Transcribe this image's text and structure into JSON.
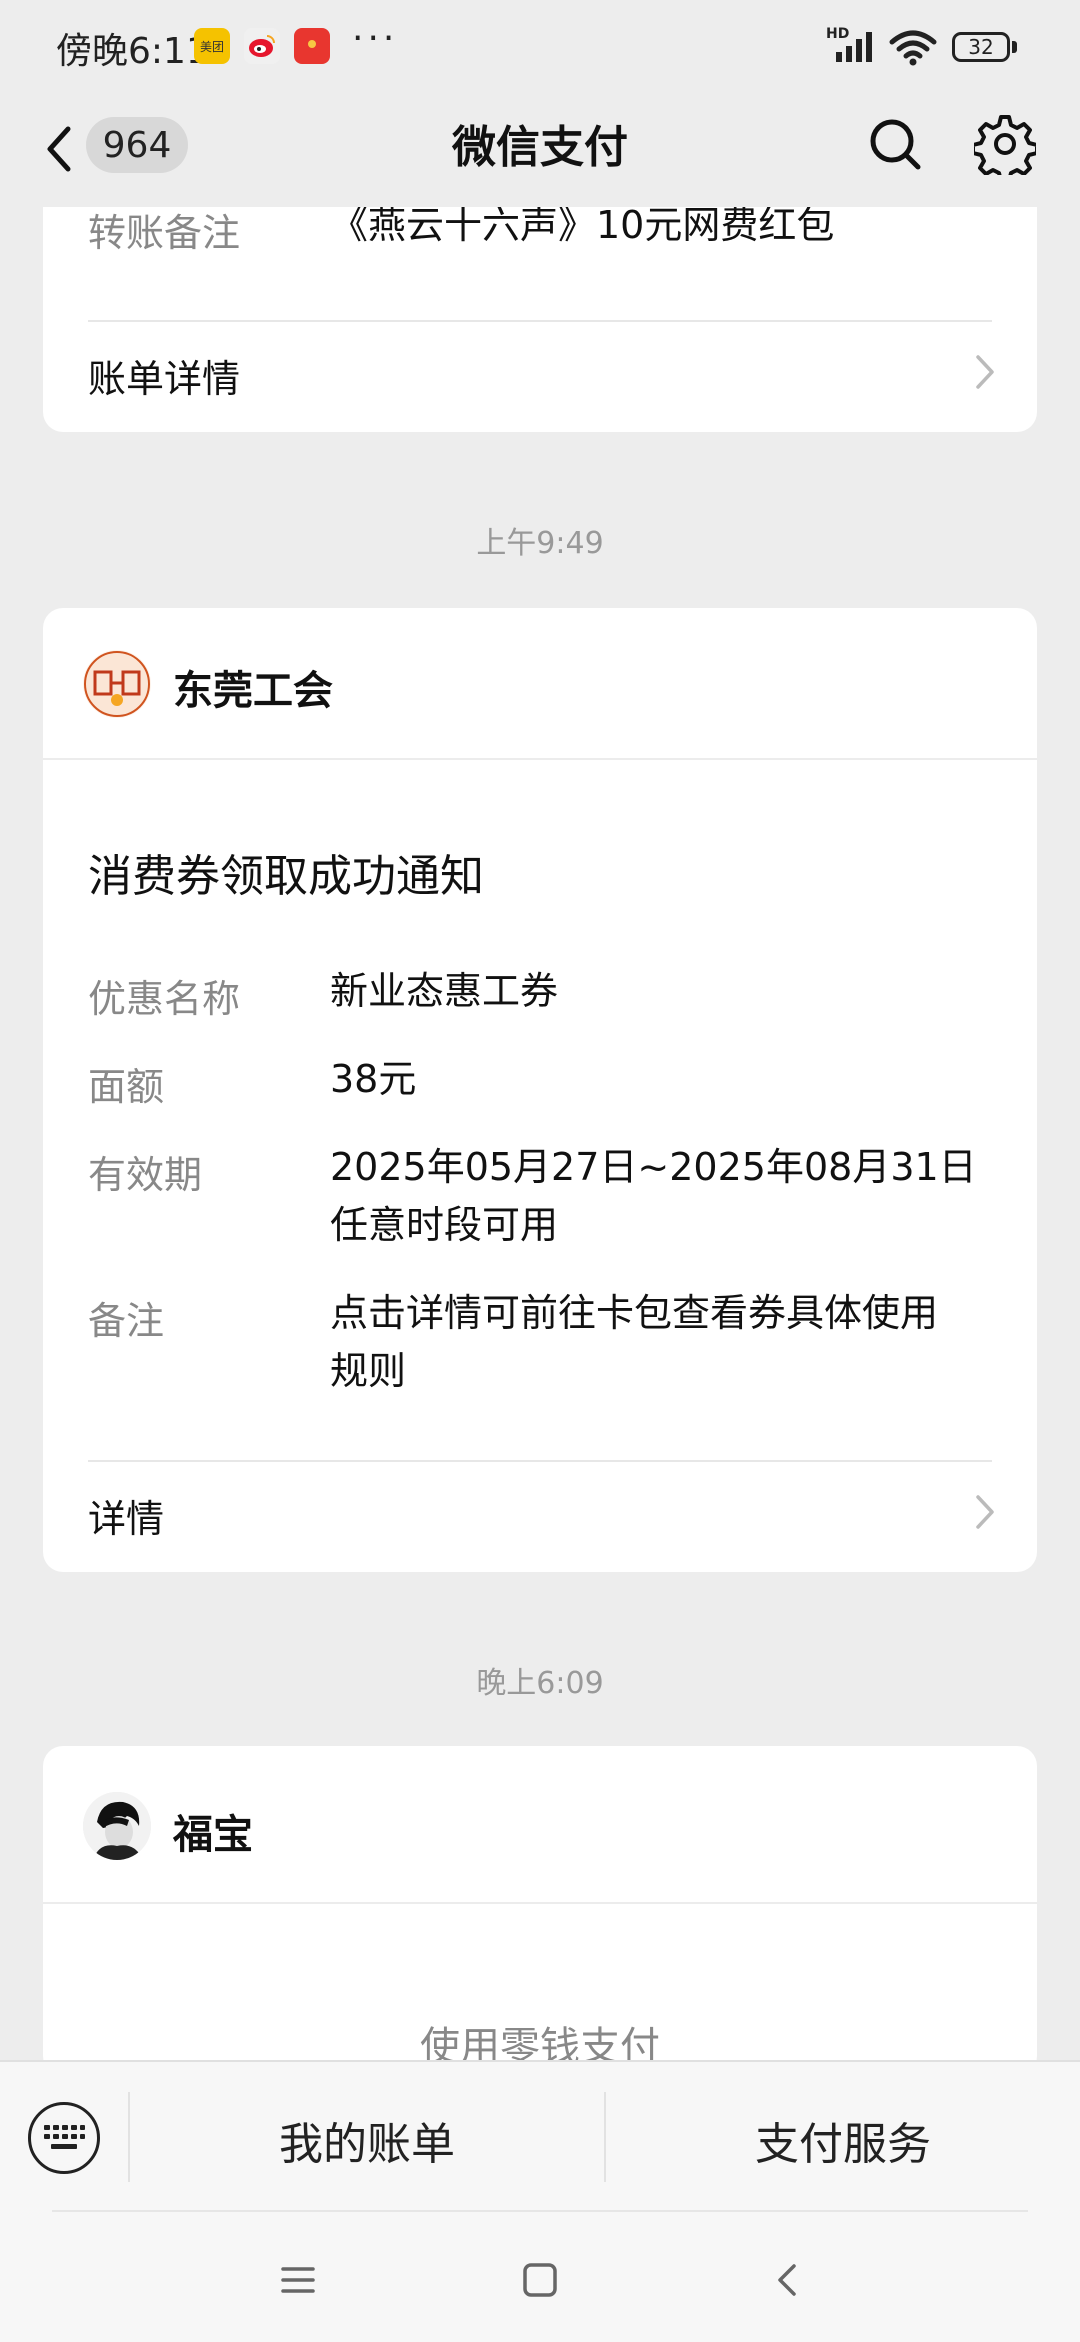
{
  "status_bar": {
    "time": "傍晚6:11",
    "apps": [
      "美团",
      "微博",
      "红包"
    ],
    "more": "···",
    "network": "HD",
    "battery": "32"
  },
  "nav": {
    "unread_count": "964",
    "title": "微信支付"
  },
  "card1": {
    "remark_label": "转账备注",
    "remark_value": "《燕云十六声》10元网费红包",
    "detail_link": "账单详情"
  },
  "time1": "上午9:49",
  "card2": {
    "sender": "东莞工会",
    "title": "消费券领取成功通知",
    "fields": [
      {
        "label": "优惠名称",
        "value": "新业态惠工券"
      },
      {
        "label": "面额",
        "value": "38元"
      },
      {
        "label": "有效期",
        "value": "2025年05月27日~2025年08月31日",
        "value2": "任意时段可用"
      },
      {
        "label": "备注",
        "value": "点击详情可前往卡包查看券具体使用",
        "value2": "规则"
      }
    ],
    "detail_link": "详情"
  },
  "time2": "晚上6:09",
  "card3": {
    "sender": "福宝",
    "body": "使用零钱支付"
  },
  "bottom": {
    "menu_bill": "我的账单",
    "menu_service": "支付服务"
  }
}
